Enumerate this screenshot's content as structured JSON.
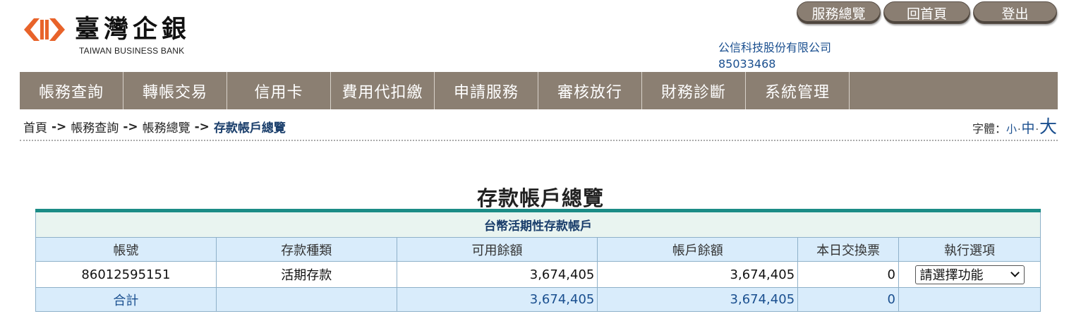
{
  "brand": {
    "name_cn": "臺灣企銀",
    "name_en": "TAIWAN BUSINESS BANK",
    "colors": {
      "logo_orange": "#e8632a",
      "nav_bg": "#8b7f72",
      "table_accent": "#1b8c86",
      "header_cell": "#d9ecfb",
      "caption_cell": "#e9f4f0"
    }
  },
  "top_buttons": {
    "overview": "服務總覽",
    "home": "回首頁",
    "logout": "登出"
  },
  "company": {
    "name": "公信科技股份有限公司",
    "id": "85033468"
  },
  "nav": {
    "items": [
      "帳務查詢",
      "轉帳交易",
      "信用卡",
      "費用代扣繳",
      "申請服務",
      "審核放行",
      "財務診斷",
      "系統管理"
    ]
  },
  "breadcrumb": {
    "home": "首頁",
    "sep": "->",
    "level1": "帳務查詢",
    "level2": "帳務總覽",
    "current": "存款帳戶總覽"
  },
  "font_size": {
    "label": "字體：",
    "small": "小",
    "medium": "中",
    "large": "大",
    "dot": "·"
  },
  "page": {
    "title": "存款帳戶總覽"
  },
  "table": {
    "caption": "台幣活期性存款帳戶",
    "headers": [
      "帳號",
      "存款種類",
      "可用餘額",
      "帳戶餘額",
      "本日交換票",
      "執行選項"
    ],
    "rows": [
      {
        "account": "86012595151",
        "type": "活期存款",
        "available": "3,674,405",
        "balance": "3,674,405",
        "clearing": "0",
        "action": "請選擇功能"
      }
    ],
    "total": {
      "label": "合計",
      "available": "3,674,405",
      "balance": "3,674,405",
      "clearing": "0"
    }
  }
}
